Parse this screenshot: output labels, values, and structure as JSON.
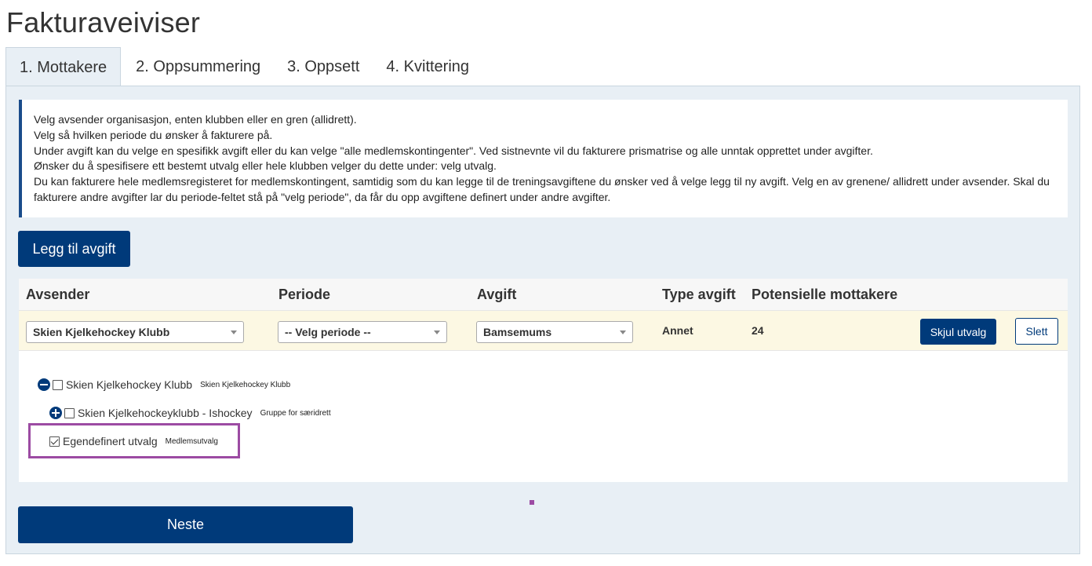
{
  "page": {
    "title": "Fakturaveiviser"
  },
  "tabs": [
    {
      "label": "1. Mottakere"
    },
    {
      "label": "2. Oppsummering"
    },
    {
      "label": "3. Oppsett"
    },
    {
      "label": "4. Kvittering"
    }
  ],
  "info": {
    "lines": [
      "Velg avsender organisasjon, enten klubben eller en gren (allidrett).",
      "Velg så hvilken periode du ønsker å fakturere på.",
      "Under avgift kan du velge en spesifikk avgift eller du kan velge \"alle medlemskontingenter\". Ved sistnevnte vil du fakturere prismatrise og alle unntak opprettet under avgifter.",
      "Ønsker du å spesifisere ett bestemt utvalg eller hele klubben velger du dette under: velg utvalg.",
      "Du kan fakturere hele medlemsregisteret for medlemskontingent, samtidig som du kan legge til de treningsavgiftene du ønsker ved å velge legg til ny avgift. Velg en av grenene/ allidrett under avsender. Skal du fakturere andre avgifter lar du periode-feltet stå på \"velg periode\", da får du opp avgiftene definert under andre avgifter."
    ]
  },
  "buttons": {
    "add_fee": "Legg til avgift",
    "hide_selection": "Skjul utvalg",
    "delete": "Slett",
    "next": "Neste"
  },
  "table": {
    "headers": {
      "sender": "Avsender",
      "period": "Periode",
      "fee": "Avgift",
      "fee_type": "Type avgift",
      "potential_recipients": "Potensielle mottakere"
    },
    "row": {
      "sender": "Skien Kjelkehockey Klubb",
      "period": "-- Velg periode --",
      "fee": "Bamsemums",
      "fee_type": "Annet",
      "potential_recipients": "24"
    }
  },
  "tree": [
    {
      "label": "Skien Kjelkehockey Klubb",
      "tag": "Skien Kjelkehockey Klubb",
      "toggle": "minus-circle-icon",
      "checked": false
    },
    {
      "label": "Skien Kjelkehockeyklubb - Ishockey",
      "tag": "Gruppe for særidrett",
      "toggle": "plus-circle-icon",
      "checked": false
    },
    {
      "label": "Egendefinert utvalg",
      "tag": "Medlemsutvalg",
      "checked": true
    }
  ],
  "colors": {
    "primary": "#003a7a",
    "panel_bg": "#e8eff5",
    "row_highlight": "#fcf8e3",
    "annotation": "#9c4ba3"
  }
}
